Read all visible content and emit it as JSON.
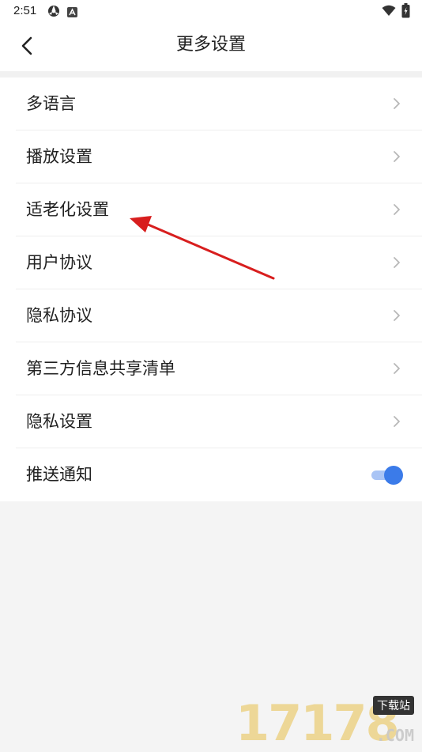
{
  "status_bar": {
    "time": "2:51",
    "icons": [
      "app-icon",
      "accessibility-badge-icon",
      "wifi-icon",
      "battery-icon"
    ]
  },
  "nav": {
    "back_icon": "chevron-left-icon",
    "title": "更多设置"
  },
  "menu": {
    "items": [
      {
        "label": "多语言",
        "trailing": "chevron-right-icon"
      },
      {
        "label": "播放设置",
        "trailing": "chevron-right-icon"
      },
      {
        "label": "适老化设置",
        "trailing": "chevron-right-icon"
      },
      {
        "label": "用户协议",
        "trailing": "chevron-right-icon"
      },
      {
        "label": "隐私协议",
        "trailing": "chevron-right-icon"
      },
      {
        "label": "第三方信息共享清单",
        "trailing": "chevron-right-icon"
      },
      {
        "label": "隐私设置",
        "trailing": "chevron-right-icon"
      },
      {
        "label": "推送通知",
        "trailing": "toggle",
        "toggle_on": true
      }
    ]
  },
  "annotation": {
    "arrow_color": "#d81e1e",
    "points_to": "适老化设置"
  },
  "watermark": {
    "digits": "17178",
    "tag": "下载站",
    "suffix": ".COM"
  },
  "colors": {
    "accent": "#3b7be9",
    "toggle_track": "#a9c4f5",
    "background": "#f4f4f4"
  }
}
